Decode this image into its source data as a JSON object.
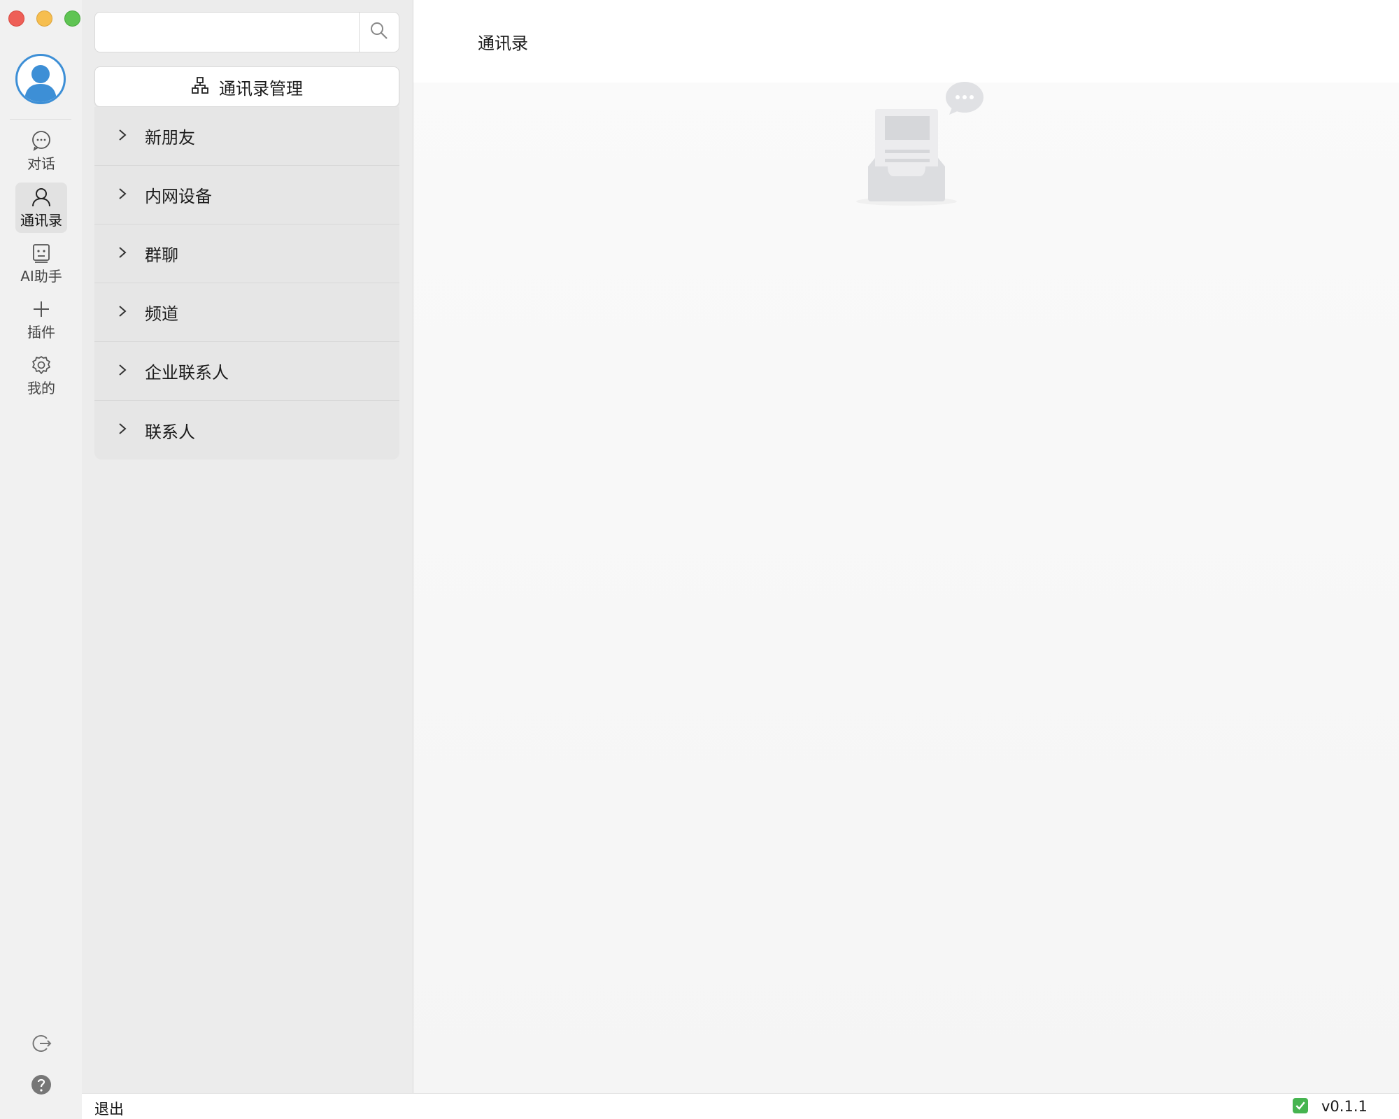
{
  "window": {
    "controls": [
      "close",
      "minimize",
      "zoom"
    ]
  },
  "sidebar": {
    "avatar_icon": "user-avatar-icon",
    "nav": [
      {
        "id": "chat",
        "label": "对话",
        "icon": "chat-bubble-icon",
        "active": false
      },
      {
        "id": "contacts",
        "label": "通讯录",
        "icon": "person-icon",
        "active": true
      },
      {
        "id": "ai",
        "label": "AI助手",
        "icon": "robot-icon",
        "active": false
      },
      {
        "id": "plugins",
        "label": "插件",
        "icon": "plus-icon",
        "active": false
      },
      {
        "id": "mine",
        "label": "我的",
        "icon": "gear-icon",
        "active": false
      }
    ],
    "bottom_icons": [
      "logout-icon",
      "help-icon"
    ]
  },
  "contacts_panel": {
    "search": {
      "value": "",
      "placeholder": ""
    },
    "manage_button": {
      "label": "通讯录管理",
      "icon": "org-chart-icon"
    },
    "groups": [
      {
        "label": "新朋友"
      },
      {
        "label": "内网设备"
      },
      {
        "label": "群聊"
      },
      {
        "label": "频道"
      },
      {
        "label": "企业联系人"
      },
      {
        "label": "联系人"
      }
    ]
  },
  "main": {
    "title": "通讯录",
    "empty_state_icon": "empty-inbox-icon"
  },
  "statusbar": {
    "logout_label": "退出",
    "status_icon": "check-icon",
    "version": "v0.1.1"
  },
  "colors": {
    "close": "#ee5f57",
    "minimize": "#f6be4f",
    "zoom": "#5fc453",
    "avatar_accent": "#3d8fd6",
    "status_ok": "#46b450"
  }
}
